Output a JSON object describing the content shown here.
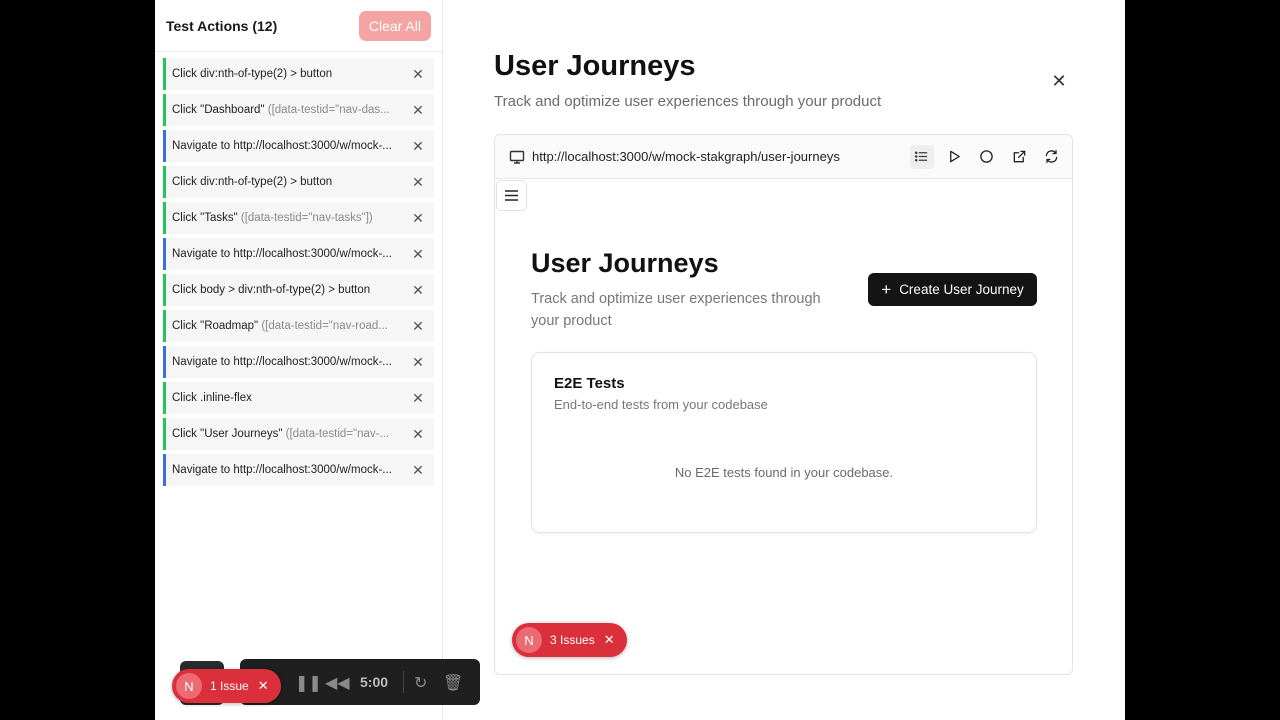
{
  "actions_panel": {
    "title": "Test Actions (12)",
    "clear_label": "Clear All",
    "items": [
      {
        "kind": "click",
        "text": "Click div:nth-of-type(2) > button",
        "meta": ""
      },
      {
        "kind": "click",
        "text": "Click \"Dashboard\" ",
        "meta": "([data-testid=\"nav-das..."
      },
      {
        "kind": "navigate",
        "text": "Navigate to http://localhost:3000/w/mock-...",
        "meta": ""
      },
      {
        "kind": "click",
        "text": "Click div:nth-of-type(2) > button",
        "meta": ""
      },
      {
        "kind": "click",
        "text": "Click \"Tasks\" ",
        "meta": "([data-testid=\"nav-tasks\"])"
      },
      {
        "kind": "navigate",
        "text": "Navigate to http://localhost:3000/w/mock-...",
        "meta": ""
      },
      {
        "kind": "click",
        "text": "Click body > div:nth-of-type(2) > button",
        "meta": ""
      },
      {
        "kind": "click",
        "text": "Click \"Roadmap\" ",
        "meta": "([data-testid=\"nav-road..."
      },
      {
        "kind": "navigate",
        "text": "Navigate to http://localhost:3000/w/mock-...",
        "meta": ""
      },
      {
        "kind": "click",
        "text": "Click .inline-flex",
        "meta": ""
      },
      {
        "kind": "click",
        "text": "Click \"User Journeys\" ",
        "meta": "([data-testid=\"nav-..."
      },
      {
        "kind": "navigate",
        "text": "Navigate to http://localhost:3000/w/mock-...",
        "meta": ""
      }
    ]
  },
  "main": {
    "title": "User Journeys",
    "subtitle": "Track and optimize user experiences through your product",
    "close_icon": "close-icon"
  },
  "browser": {
    "url": "http://localhost:3000/w/mock-stakgraph/user-journeys",
    "toolbar_icons": [
      "list-icon",
      "play-icon",
      "record-circle-icon",
      "external-link-icon",
      "refresh-icon"
    ]
  },
  "preview": {
    "title": "User Journeys",
    "subtitle": "Track and optimize user experiences through your product",
    "create_label": "Create User Journey",
    "card": {
      "title": "E2E Tests",
      "subtitle": "End-to-end tests from your codebase",
      "empty": "No E2E tests found in your codebase."
    }
  },
  "issues": {
    "inner": {
      "avatar": "N",
      "label": "3 Issues"
    },
    "outer": {
      "avatar": "N",
      "label": "1 Issue"
    }
  },
  "recorder": {
    "time": "5:00"
  },
  "colors": {
    "click_accent": "#22c55e",
    "navigate_accent": "#3b6fe0",
    "issue_red": "#dc2f3c",
    "clear_button": "#f5a4a4"
  }
}
